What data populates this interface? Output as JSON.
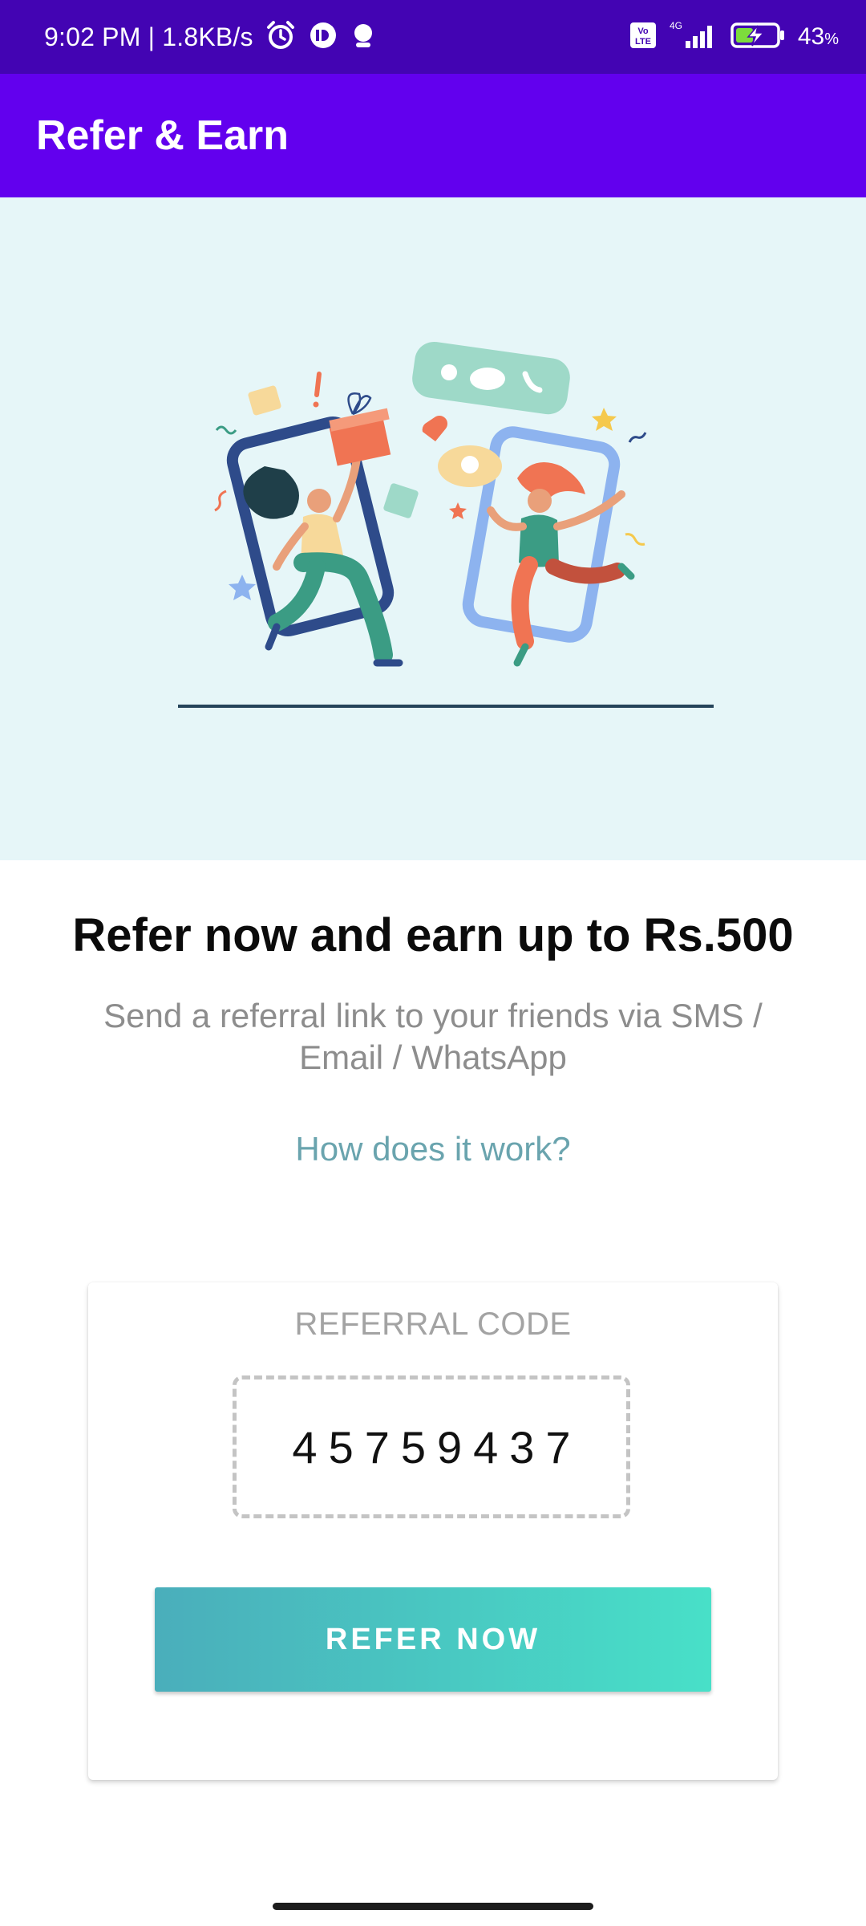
{
  "status_bar": {
    "time": "9:02 PM | 1.8KB/s",
    "network": "4G",
    "volte_label": "Vo LTE",
    "battery_percent": "43",
    "battery_unit": "%",
    "battery_level": 0.43,
    "icons": [
      "alarm-icon",
      "messenger-icon",
      "notification-icon",
      "volte-icon",
      "signal-icon",
      "battery-charging-icon"
    ]
  },
  "app_bar": {
    "title": "Refer & Earn",
    "color": "#6200ee"
  },
  "hero": {
    "illustration": "two-people-jumping-out-of-phones",
    "background": "#e6f6f8"
  },
  "content": {
    "headline": "Refer now and earn up to Rs.500",
    "subtext": "Send a referral link to your friends via SMS / Email / WhatsApp",
    "how_link": "How does it work?"
  },
  "referral_card": {
    "label": "REFERRAL CODE",
    "code": "45759437",
    "button_label": "REFER NOW",
    "button_gradient": [
      "#4aaebb",
      "#48e0c8"
    ]
  }
}
